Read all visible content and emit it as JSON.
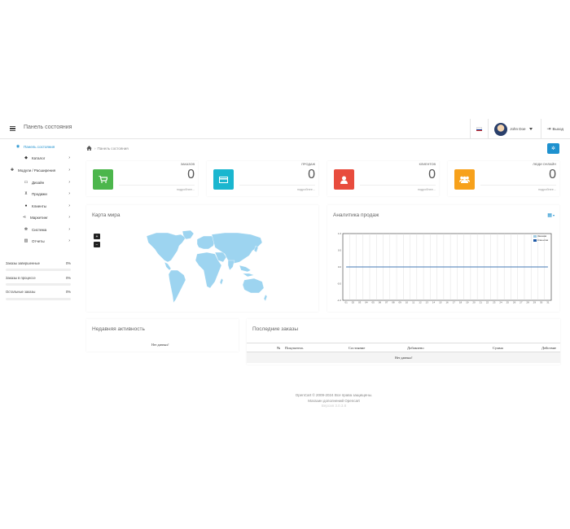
{
  "header": {
    "title": "Панель состояния",
    "user_name": "John Doe",
    "logout_label": "Выход"
  },
  "sidebar": {
    "items": [
      {
        "label": "Панель состояния",
        "icon": "dashboard-icon",
        "active": true,
        "has_children": false
      },
      {
        "label": "Каталог",
        "icon": "tag-icon",
        "active": false,
        "has_children": true
      },
      {
        "label": "Модули / Расширения",
        "icon": "puzzle-icon",
        "active": false,
        "has_children": true
      },
      {
        "label": "Дизайн",
        "icon": "monitor-icon",
        "active": false,
        "has_children": true
      },
      {
        "label": "Продажи",
        "icon": "cart-icon",
        "active": false,
        "has_children": true
      },
      {
        "label": "Клиенты",
        "icon": "user-icon",
        "active": false,
        "has_children": true
      },
      {
        "label": "Маркетинг",
        "icon": "share-icon",
        "active": false,
        "has_children": true
      },
      {
        "label": "Система",
        "icon": "gear-icon",
        "active": false,
        "has_children": true
      },
      {
        "label": "Отчеты",
        "icon": "bar-chart-icon",
        "active": false,
        "has_children": true
      }
    ],
    "stats": [
      {
        "label": "Заказы завершенные",
        "value": "0%",
        "progress": 0
      },
      {
        "label": "Заказы в процессе",
        "value": "0%",
        "progress": 0
      },
      {
        "label": "Остальные заказы",
        "value": "0%",
        "progress": 0
      }
    ]
  },
  "breadcrumb": {
    "current": "Панель состояния"
  },
  "tiles": [
    {
      "label": "ЗАКАЗОВ",
      "value": "0",
      "more": "подробнее...",
      "color": "#4cb64c",
      "icon": "cart-icon"
    },
    {
      "label": "ПРОДАЖ",
      "value": "0",
      "more": "подробнее...",
      "color": "#1ab6cf",
      "icon": "credit-card-icon"
    },
    {
      "label": "КЛИЕНТОВ",
      "value": "0",
      "more": "подробнее...",
      "color": "#e84c3d",
      "icon": "user-icon"
    },
    {
      "label": "ЛЮДИ ОНЛАЙН",
      "value": "0",
      "more": "подробнее...",
      "color": "#f7a11b",
      "icon": "users-icon"
    }
  ],
  "world_map": {
    "title": "Карта мира",
    "zoom_in": "+",
    "zoom_out": "−",
    "land_color": "#9dd4f0"
  },
  "sales_analytics": {
    "title": "Аналитика продаж"
  },
  "chart_data": {
    "type": "line",
    "x": [
      "01",
      "02",
      "03",
      "04",
      "05",
      "06",
      "07",
      "08",
      "09",
      "10",
      "11",
      "12",
      "13",
      "14",
      "15",
      "16",
      "17",
      "18",
      "19",
      "20",
      "21",
      "22",
      "23",
      "24",
      "25",
      "26",
      "27",
      "28",
      "29",
      "30",
      "31"
    ],
    "yticks": [
      "1.0",
      "0.5",
      "0.0",
      "-0.5",
      "-1.0"
    ],
    "ylim": [
      -1.0,
      1.0
    ],
    "series": [
      {
        "name": "Заказов",
        "values": [
          0,
          0,
          0,
          0,
          0,
          0,
          0,
          0,
          0,
          0,
          0,
          0,
          0,
          0,
          0,
          0,
          0,
          0,
          0,
          0,
          0,
          0,
          0,
          0,
          0,
          0,
          0,
          0,
          0,
          0,
          0
        ],
        "color": "#9ecae1"
      },
      {
        "name": "Клиентов",
        "values": [
          0,
          0,
          0,
          0,
          0,
          0,
          0,
          0,
          0,
          0,
          0,
          0,
          0,
          0,
          0,
          0,
          0,
          0,
          0,
          0,
          0,
          0,
          0,
          0,
          0,
          0,
          0,
          0,
          0,
          0,
          0
        ],
        "color": "#1f5aa6"
      }
    ],
    "grid": true,
    "legend": "top-right"
  },
  "recent_activity": {
    "title": "Недавняя активность",
    "empty": "Нет данных!"
  },
  "latest_orders": {
    "title": "Последние заказы",
    "columns": [
      "№",
      "Покупатель",
      "Состояние",
      "Добавлено",
      "Сумма",
      "Действие"
    ],
    "empty": "Нет данных!"
  },
  "footer": {
    "line1": "OpenCart © 2009-2024 Все права защищены.",
    "line2": "Магазин дополнений Opencart",
    "line3": "Версия 3.0.3.8"
  }
}
